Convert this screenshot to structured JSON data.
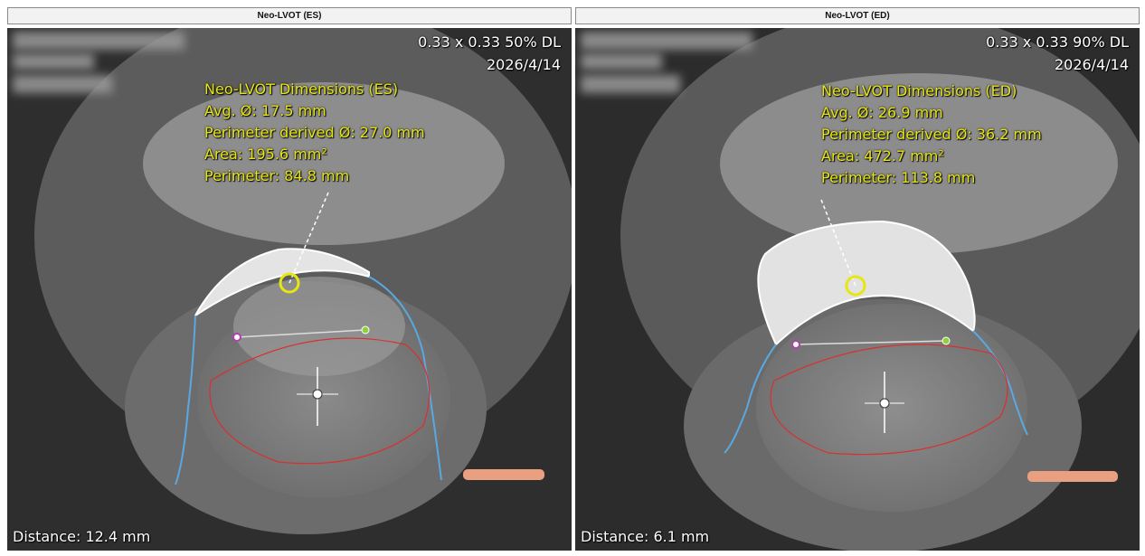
{
  "panels": [
    {
      "title": "Neo-LVOT (ES)",
      "pixel_spacing": "0.33 x 0.33 50% DL",
      "date": "2026/4/14",
      "measurements": {
        "heading": "Neo-LVOT Dimensions (ES)",
        "avg": "Avg. Ø: 17.5 mm",
        "perimeter_derived": "Perimeter derived Ø: 27.0 mm",
        "area": "Area: 195.6 mm²",
        "perimeter": "Perimeter: 84.8 mm"
      },
      "distance": "Distance: 12.4 mm"
    },
    {
      "title": "Neo-LVOT (ED)",
      "pixel_spacing": "0.33 x 0.33 90% DL",
      "date": "2026/4/14",
      "measurements": {
        "heading": "Neo-LVOT Dimensions (ED)",
        "avg": "Avg. Ø: 26.9 mm",
        "perimeter_derived": "Perimeter derived Ø: 36.2 mm",
        "area": "Area: 472.7 mm²",
        "perimeter": "Perimeter: 113.8 mm"
      },
      "distance": "Distance: 6.1 mm"
    }
  ],
  "colors": {
    "measurement_text": "#e6e612",
    "annulus_line": "#5aa8e0",
    "device_outline": "#d83030",
    "neo_lvot_fill": "#e8e8e8"
  }
}
